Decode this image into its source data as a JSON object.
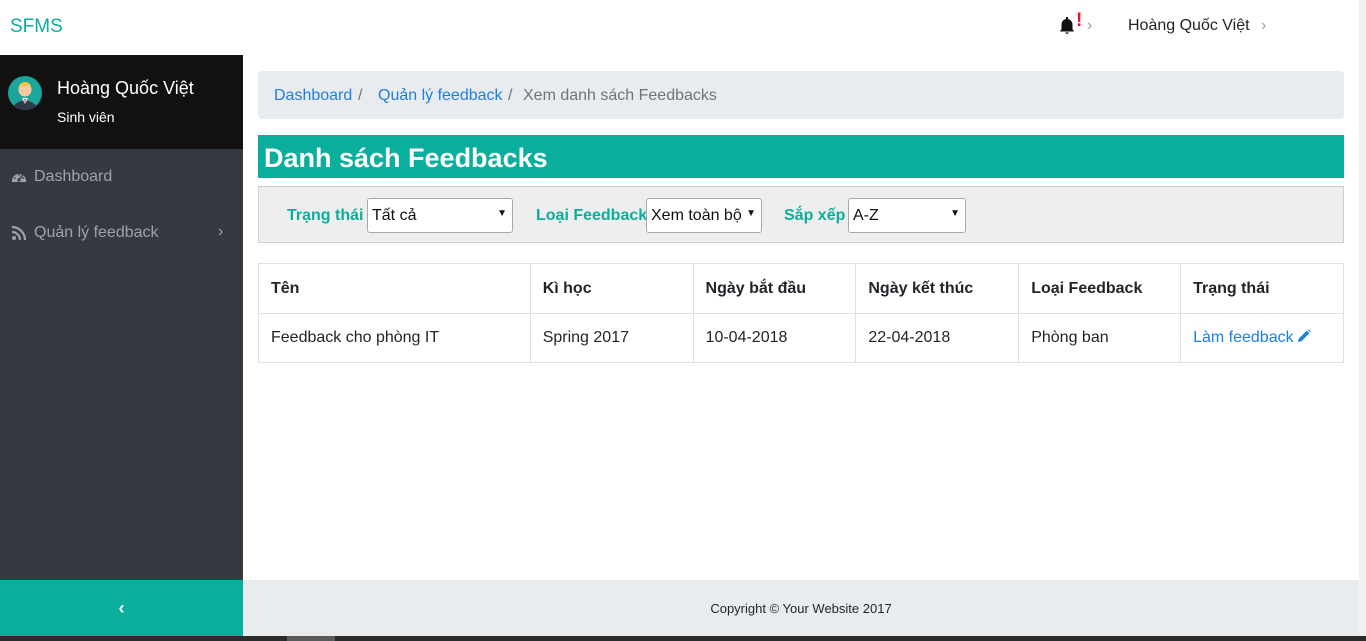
{
  "topbar": {
    "brand": "SFMS",
    "alert_mark": "!",
    "user_name": "Hoàng Quốc Việt",
    "bell_icon": "bell-icon",
    "colors": {
      "brand": "#0aae9c",
      "alert": "#e8112d"
    }
  },
  "sidebar": {
    "profile": {
      "name": "Hoàng Quốc Việt",
      "role": "Sinh viên",
      "avatar_icon": "user-avatar-icon"
    },
    "items": [
      {
        "label": "Dashboard",
        "icon": "dashboard-gauge-icon"
      },
      {
        "label": "Quản lý feedback",
        "icon": "rss-feed-icon"
      }
    ],
    "toggle_icon": "chevron-left-icon",
    "colors": {
      "background": "#343a40",
      "profile_bg": "#111111",
      "toggle_bg": "#0aae9c"
    }
  },
  "breadcrumb": {
    "items": [
      "Dashboard",
      "Quản lý feedback"
    ],
    "active": "Xem danh sách Feedbacks",
    "separator": "/"
  },
  "page_title": "Danh sách Feedbacks",
  "filters": {
    "status": {
      "label": "Trạng thái",
      "value": "Tất cả"
    },
    "type": {
      "label": "Loại Feedback",
      "value": "Xem toàn bộ"
    },
    "sort": {
      "label": "Sắp xếp",
      "value": "A-Z"
    }
  },
  "table": {
    "headers": [
      "Tên",
      "Kì học",
      "Ngày bắt đầu",
      "Ngày kết thúc",
      "Loại Feedback",
      "Trạng thái"
    ],
    "rows": [
      {
        "name": "Feedback cho phòng IT",
        "semester": "Spring 2017",
        "start": "10-04-2018",
        "end": "22-04-2018",
        "type": "Phòng ban",
        "status_link": "Làm feedback",
        "status_icon": "pencil-icon"
      }
    ]
  },
  "footer": {
    "text": "Copyright © Your Website 2017"
  }
}
